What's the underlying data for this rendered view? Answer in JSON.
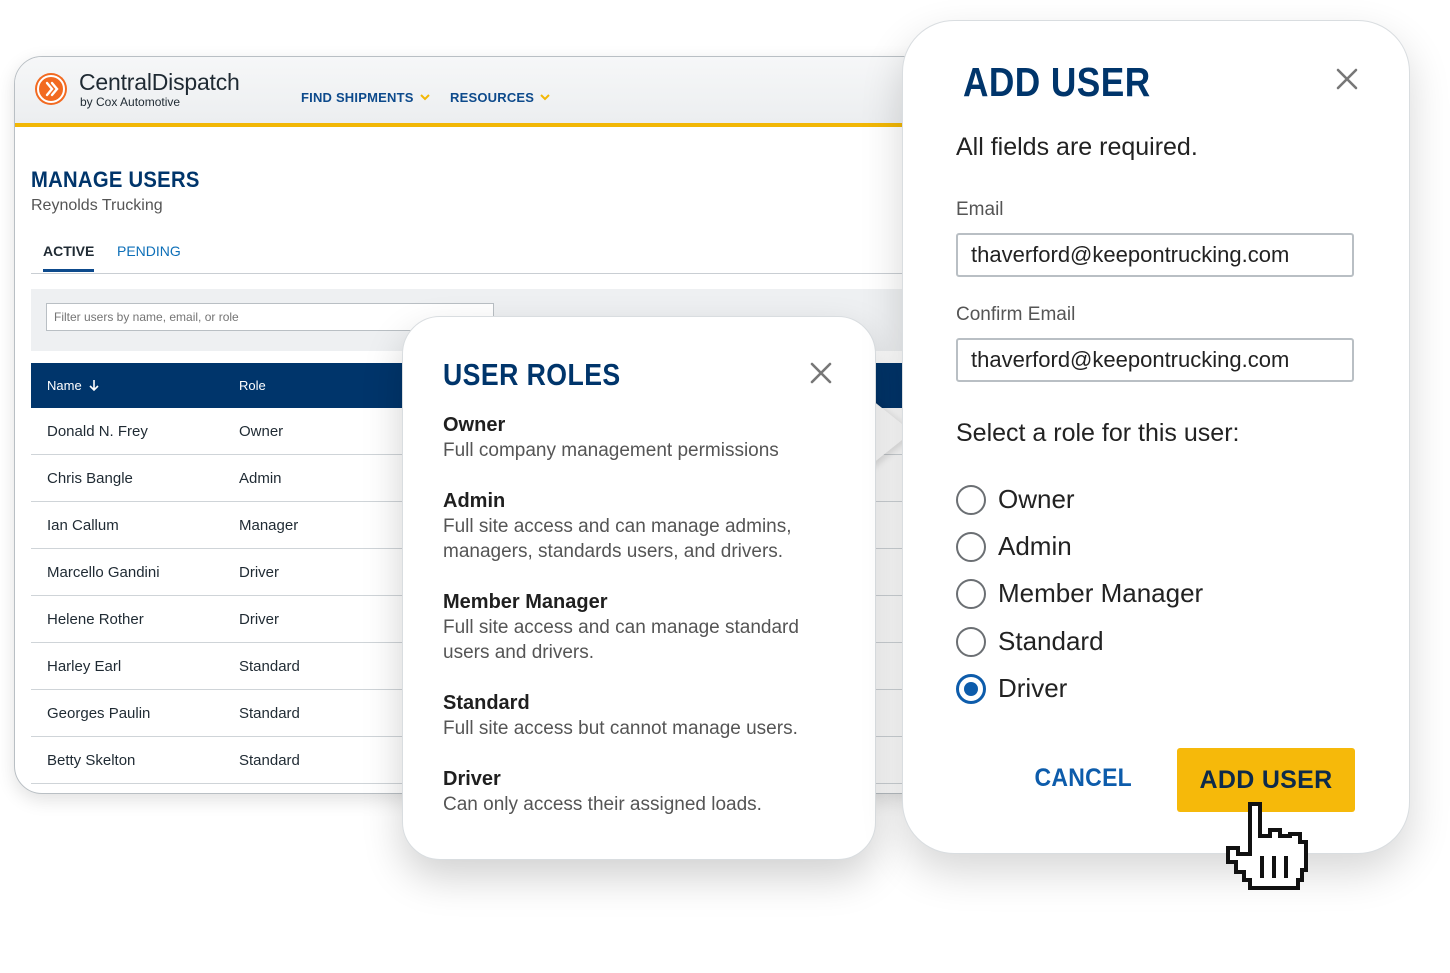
{
  "app": {
    "logo_name": "CentralDispatch",
    "logo_sub": "by Cox Automotive",
    "nav": [
      "FIND SHIPMENTS",
      "RESOURCES"
    ],
    "page_title": "MANAGE USERS",
    "company": "Reynolds Trucking",
    "tabs": {
      "active": "ACTIVE",
      "pending": "PENDING"
    },
    "filter_placeholder": "Filter users by name, email, or role",
    "columns": {
      "name": "Name",
      "role": "Role"
    },
    "rows": [
      {
        "name": "Donald N. Frey",
        "role": "Owner"
      },
      {
        "name": "Chris Bangle",
        "role": "Admin"
      },
      {
        "name": "Ian Callum",
        "role": "Manager"
      },
      {
        "name": "Marcello Gandini",
        "role": "Driver"
      },
      {
        "name": "Helene Rother",
        "role": "Driver"
      },
      {
        "name": "Harley Earl",
        "role": "Standard"
      },
      {
        "name": "Georges Paulin",
        "role": "Standard"
      },
      {
        "name": "Betty Skelton",
        "role": "Standard"
      }
    ]
  },
  "roles_popover": {
    "title": "USER ROLES",
    "roles": [
      {
        "name": "Owner",
        "desc": "Full company management permissions"
      },
      {
        "name": "Admin",
        "desc": "Full site access and can manage admins, managers, standards users, and drivers."
      },
      {
        "name": "Member Manager",
        "desc": "Full site access and can manage standard users and drivers."
      },
      {
        "name": "Standard",
        "desc": "Full site access but cannot manage users."
      },
      {
        "name": "Driver",
        "desc": "Can only access their assigned loads."
      }
    ]
  },
  "modal": {
    "title": "ADD USER",
    "note": "All fields are required.",
    "email_label": "Email",
    "email_value": "thaverford@keepontrucking.com",
    "confirm_label": "Confirm Email",
    "confirm_value": "thaverford@keepontrucking.com",
    "role_prompt": "Select a role for this user:",
    "role_options": [
      "Owner",
      "Admin",
      "Member Manager",
      "Standard",
      "Driver"
    ],
    "selected_role": "Driver",
    "cancel_label": "CANCEL",
    "submit_label": "ADD USER"
  },
  "colors": {
    "brand_navy": "#00356b",
    "accent_yellow": "#f6b90a",
    "link_blue": "#0d5cab",
    "logo_orange": "#f26a21"
  },
  "icons": [
    "logo-mark-icon",
    "chevron-down-icon",
    "sort-down-arrow-icon",
    "close-icon",
    "pointer-hand-cursor-icon"
  ]
}
